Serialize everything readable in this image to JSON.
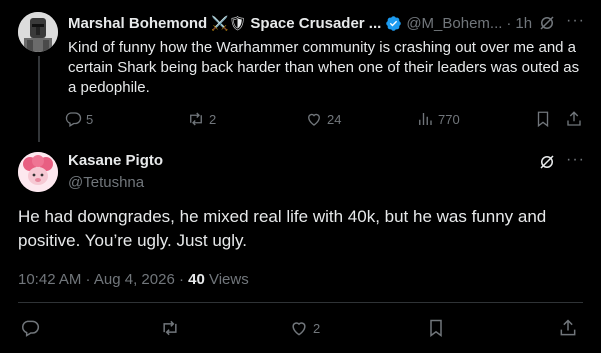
{
  "parent_tweet": {
    "author_name": "Marshal Bohemond",
    "name_emoji": "⚔️🛡",
    "name_suffix": "Space Crusader ...",
    "handle": "@M_Bohem...",
    "time": "1h",
    "text": "Kind of funny how the Warhammer community is crashing out over me and a certain Shark being back harder than when one of their leaders was outed as a pedophile.",
    "replies": "5",
    "reposts": "2",
    "likes": "24",
    "views": "770"
  },
  "reply_tweet": {
    "author_name": "Kasane Pigto",
    "handle": "@Tetushna",
    "text": "He had downgrades, he mixed real life with 40k, but he was funny and positive. You’re ugly. Just ugly.",
    "timestamp": "10:42 AM · Aug 4, 2026 · ",
    "views_count": "40",
    "views_label": "Views",
    "likes": "2"
  },
  "icons": {
    "verified": "verified-badge-icon",
    "grok": "grok-icon",
    "more": "more-icon",
    "reply": "reply-icon",
    "repost": "repost-icon",
    "like": "heart-icon",
    "views": "views-icon",
    "bookmark": "bookmark-icon",
    "share": "share-icon"
  },
  "colors": {
    "background": "#000000",
    "text": "#e7e9ea",
    "secondary": "#71767b",
    "verified": "#1d9bf0",
    "divider": "#2f3336"
  }
}
